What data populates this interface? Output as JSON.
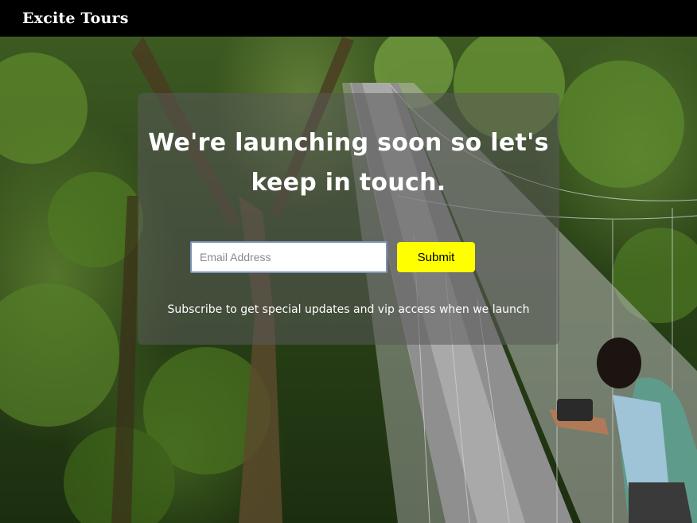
{
  "navbar": {
    "brand": "Excite Tours"
  },
  "hero": {
    "headline": "We're launching soon so let's keep in touch.",
    "email_placeholder": "Email Address",
    "submit_label": "Submit",
    "subtext": "Subscribe to get special updates and vip access when we launch",
    "background_image": "canopy-bridge-photo"
  },
  "colors": {
    "navbar_bg": "#000000",
    "submit_bg": "#ffff00",
    "panel_bg": "rgba(90,90,90,0.55)"
  }
}
